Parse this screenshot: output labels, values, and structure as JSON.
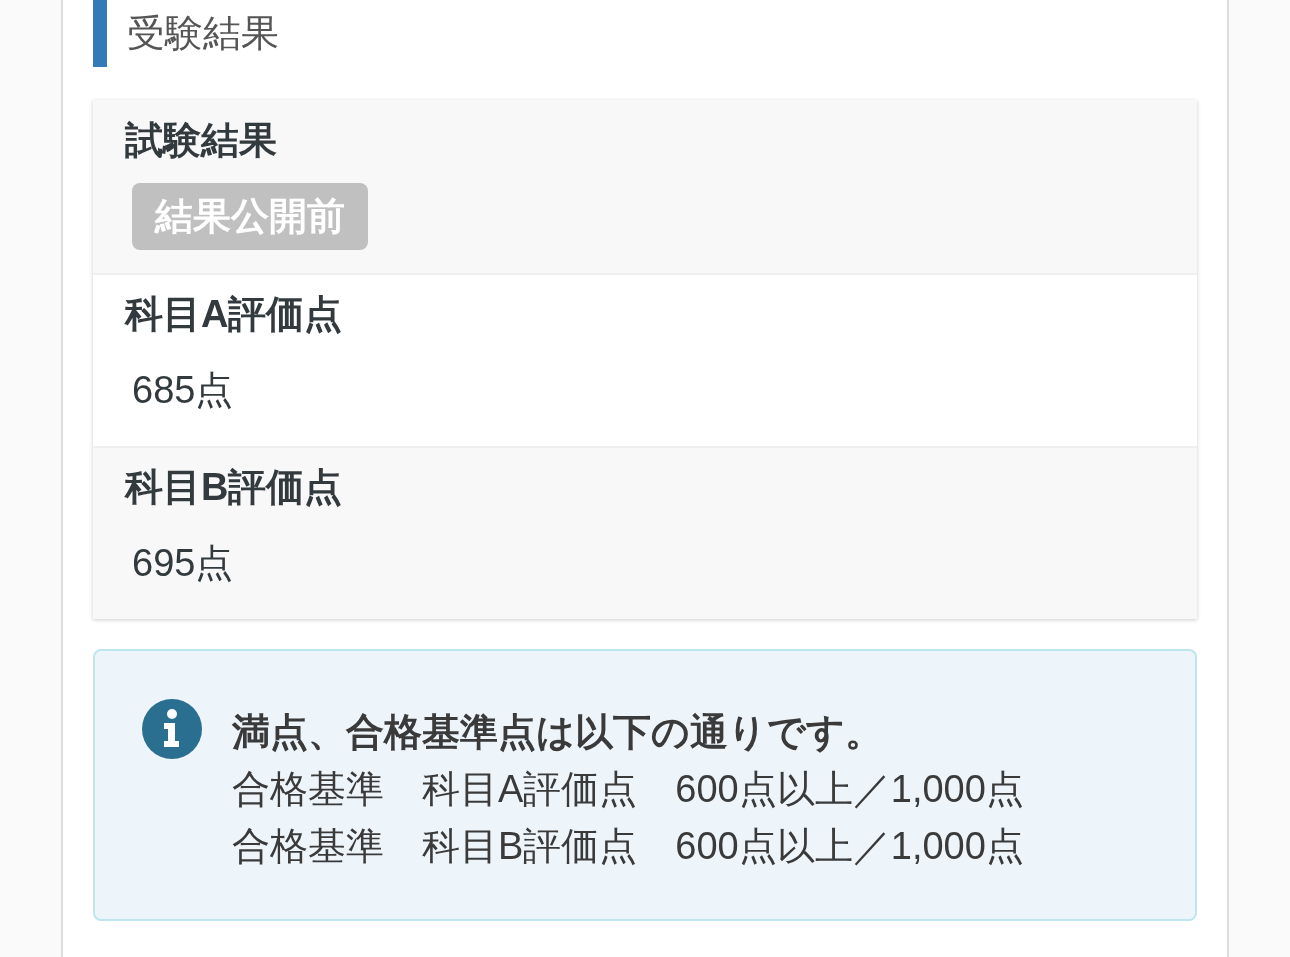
{
  "section_heading": "受験結果",
  "result_card": {
    "items": [
      {
        "kind": "status",
        "label": "試験結果",
        "badge": "結果公開前"
      },
      {
        "kind": "score",
        "label": "科目A評価点",
        "value": "685点"
      },
      {
        "kind": "score",
        "label": "科目B評価点",
        "value": "695点"
      }
    ]
  },
  "info_box": {
    "title": "満点、合格基準点は以下の通りです。",
    "lines": [
      "合格基準　科目A評価点　600点以上／1,000点",
      "合格基準　科目B評価点　600点以上／1,000点"
    ]
  }
}
